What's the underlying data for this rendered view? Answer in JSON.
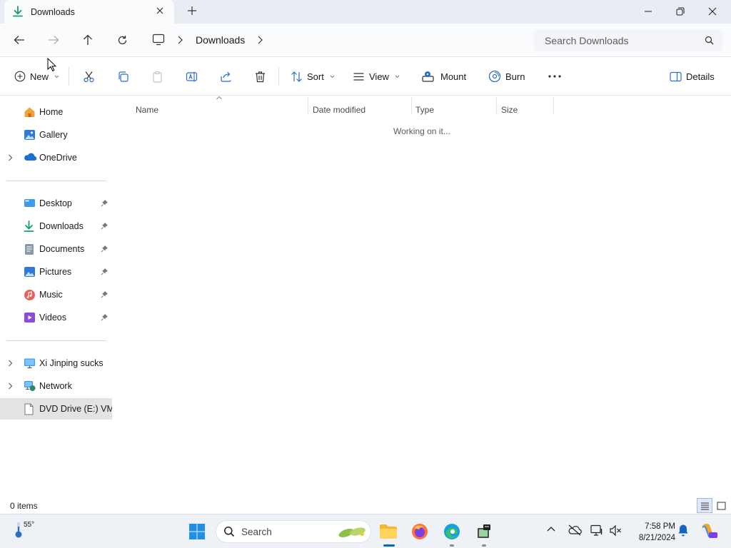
{
  "window": {
    "tab_title": "Downloads",
    "colors": {
      "titlebar": "#e8edf3",
      "accent": "#0067c0"
    }
  },
  "address": {
    "crumbs": [
      "Downloads"
    ],
    "search_placeholder": "Search Downloads"
  },
  "commands": {
    "new_label": "New",
    "sort_label": "Sort",
    "view_label": "View",
    "mount_label": "Mount",
    "burn_label": "Burn",
    "details_label": "Details"
  },
  "sidebar": {
    "quick": [
      {
        "label": "Home",
        "icon": "home-icon"
      },
      {
        "label": "Gallery",
        "icon": "gallery-icon"
      },
      {
        "label": "OneDrive",
        "icon": "onedrive-icon"
      }
    ],
    "pinned": [
      {
        "label": "Desktop",
        "icon": "desktop-folder-icon"
      },
      {
        "label": "Downloads",
        "icon": "downloads-folder-icon"
      },
      {
        "label": "Documents",
        "icon": "documents-folder-icon"
      },
      {
        "label": "Pictures",
        "icon": "pictures-folder-icon"
      },
      {
        "label": "Music",
        "icon": "music-folder-icon"
      },
      {
        "label": "Videos",
        "icon": "videos-folder-icon"
      }
    ],
    "devices": [
      {
        "label": "Xi Jinping sucks",
        "icon": "this-pc-icon"
      },
      {
        "label": "Network",
        "icon": "network-icon"
      },
      {
        "label": "DVD Drive (E:) VMware Tools",
        "icon": "dvd-drive-icon"
      }
    ]
  },
  "columns": [
    "Name",
    "Date modified",
    "Type",
    "Size"
  ],
  "content": {
    "status_message": "Working on it..."
  },
  "statusbar": {
    "item_count": "0 items"
  },
  "taskbar": {
    "weather_temp": "55°",
    "search_placeholder": "Search",
    "time": "7:58 PM",
    "date": "8/21/2024"
  }
}
